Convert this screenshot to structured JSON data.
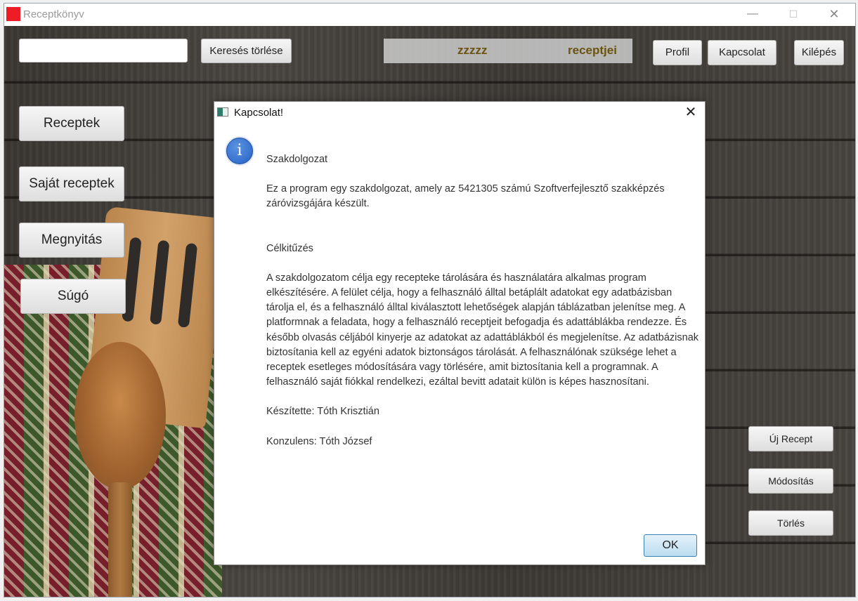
{
  "window": {
    "title": "Receptkönyv",
    "minimize": "—",
    "maximize": "☐",
    "close": "✕"
  },
  "toolbar": {
    "search_value": "",
    "clear_search": "Keresés törlése",
    "banner_user": "zzzzz",
    "banner_suffix": "receptjei",
    "profile": "Profil",
    "contact": "Kapcsolat",
    "logout": "Kilépés"
  },
  "sidebar": {
    "recipes": "Receptek",
    "own_recipes": "Saját receptek",
    "open": "Megnyitás",
    "help": "Súgó"
  },
  "actions": {
    "new_recipe": "Új Recept",
    "modify": "Módosítás",
    "delete": "Törlés"
  },
  "dialog": {
    "title": "Kapcsolat!",
    "close": "✕",
    "icon": "i",
    "heading1": "Szakdolgozat",
    "para1": "Ez a program egy szakdolgozat, amely az 5421305 számú Szoftverfejlesztő szakképzés záróvizsgájára készült.",
    "heading2": "Célkitűzés",
    "para2": "A szakdolgozatom célja egy recepteke tárolására és használatára alkalmas program elkészítésére. A felület célja, hogy a felhasználó álltal betáplált adatokat egy adatbázisban tárolja el, és a felhasználó álltal kiválasztott lehetőségek alapján táblázatban jelenítse meg. A platformnak a feladata, hogy a felhasználó receptjeit befogadja és adattáblákba rendezze. És később olvasás céljából kinyerje az adatokat az adattáblákból és megjelenítse. Az adatbázisnak biztosítania kell az egyéni adatok biztonságos tárolását. A felhasználónak szüksége lehet a receptek esetleges módosítására vagy törlésére, amit biztosítania kell a programnak. A felhasználó saját fiókkal rendelkezi, ezáltal bevitt adatait külön is képes hasznosítani.",
    "author": "Készítette: Tóth Krisztián",
    "consultant": "Konzulens: Tóth József",
    "ok": "OK"
  },
  "colors": {
    "app_icon": "#ee1c24",
    "banner_text": "#6b5310",
    "info_icon": "#2561c7",
    "ok_border": "#3c7fb1"
  },
  "icons": [
    "app-icon",
    "info-icon",
    "close-icon",
    "minimize-icon",
    "maximize-icon",
    "dialog-app-icon"
  ]
}
